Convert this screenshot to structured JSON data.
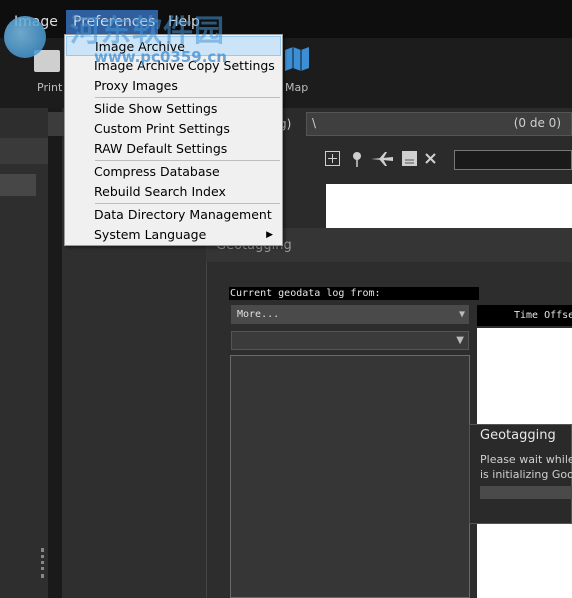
{
  "menubar": {
    "items": [
      "Image",
      "Preferences",
      "Help"
    ]
  },
  "toolbar": {
    "print_label": "Print",
    "map_label": "Map"
  },
  "pathbar": {
    "prev_fragment": "g)",
    "path": "\\",
    "count": "(0 de 0)"
  },
  "preferences_menu": {
    "items": [
      {
        "label": "Image Archive",
        "selected": true
      },
      {
        "label": "Image Archive Copy Settings"
      },
      {
        "label": "Proxy Images"
      },
      {
        "label": "Slide Show Settings"
      },
      {
        "label": "Custom Print Settings"
      },
      {
        "label": "RAW Default Settings"
      },
      {
        "label": "Compress Database"
      },
      {
        "label": "Rebuild Search Index"
      },
      {
        "label": "Data Directory Management"
      },
      {
        "label": "System Language",
        "has_submenu": true
      }
    ]
  },
  "geotagging": {
    "title": "Geotagging",
    "log_label": "Current geodata log from:",
    "source_value": "More...",
    "time_offset_header": "Time Offse"
  },
  "popup": {
    "title": "Geotagging",
    "message_line1": "Please wait while",
    "message_line2": "is initializing Goo"
  },
  "watermark": {
    "text": "河东软件园",
    "url": "www.pc0359.cn"
  },
  "colors": {
    "menu_highlight": "#2f5f9e",
    "selected_item": "#cce4f7",
    "map_icon": "#3a8fd6"
  }
}
